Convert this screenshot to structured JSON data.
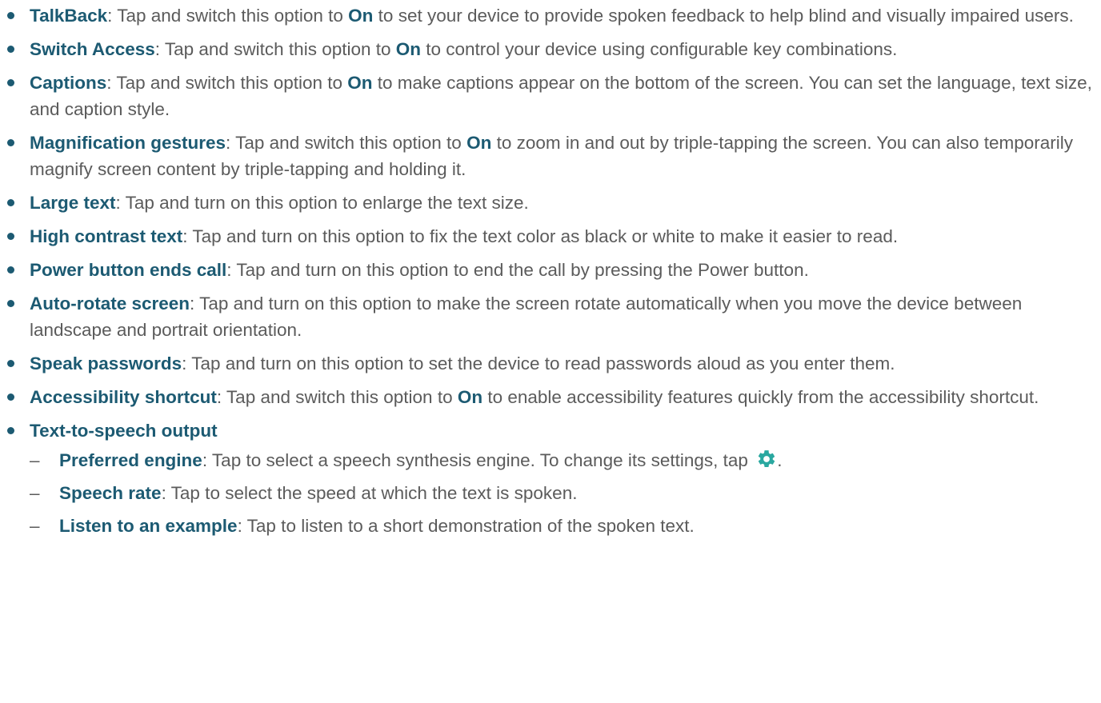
{
  "on_word": "On",
  "items": [
    {
      "term": "TalkBack",
      "pre": ": Tap and switch this option to ",
      "post": " to set your device to provide spoken feedback to help blind and visually impaired users."
    },
    {
      "term": "Switch Access",
      "pre": ": Tap and switch this option to ",
      "post": " to control your device using configurable key combinations."
    },
    {
      "term": "Captions",
      "pre": ": Tap and switch this option to ",
      "post": " to make captions appear on the bottom of the screen. You can set the language, text size, and caption style."
    },
    {
      "term": "Magnification gestures",
      "pre": ": Tap and switch this option to ",
      "post": " to zoom in and out by triple-tapping the screen. You can also temporarily magnify screen content by triple-tapping and holding it."
    },
    {
      "term": "Large text",
      "text": ": Tap and turn on this option to enlarge the text size."
    },
    {
      "term": "High contrast text",
      "text": ": Tap and turn on this option to fix the text color as black or white to make it easier to read."
    },
    {
      "term": "Power button ends call",
      "text": ": Tap and turn on this option to end the call by pressing the Power button."
    },
    {
      "term": "Auto-rotate screen",
      "text": ": Tap and turn on this option to make the screen rotate automatically when you move the device between landscape and portrait orientation."
    },
    {
      "term": "Speak passwords",
      "text": ": Tap and turn on this option to set the device to read passwords aloud as you enter them."
    },
    {
      "term": "Accessibility shortcut",
      "pre": ": Tap and switch this option to ",
      "post": " to enable accessibility features quickly from the accessibility shortcut."
    }
  ],
  "tts": {
    "term": "Text-to-speech output",
    "subitems": [
      {
        "dash": "–",
        "term": "Preferred engine",
        "text": ": Tap to select a speech synthesis engine. To change its settings, tap",
        "trail": "."
      },
      {
        "dash": "–",
        "term": "Speech rate",
        "text": ": Tap to select the speed at which the text is spoken."
      },
      {
        "dash": "–",
        "term": "Listen to an example",
        "text": ": Tap to listen to a short demonstration of the spoken text."
      }
    ]
  },
  "colors": {
    "accent": "#1c5a72",
    "body_text": "#5b5b5b",
    "gear_icon": "#2aa8a0"
  },
  "icons": {
    "settings": "gear-icon"
  }
}
